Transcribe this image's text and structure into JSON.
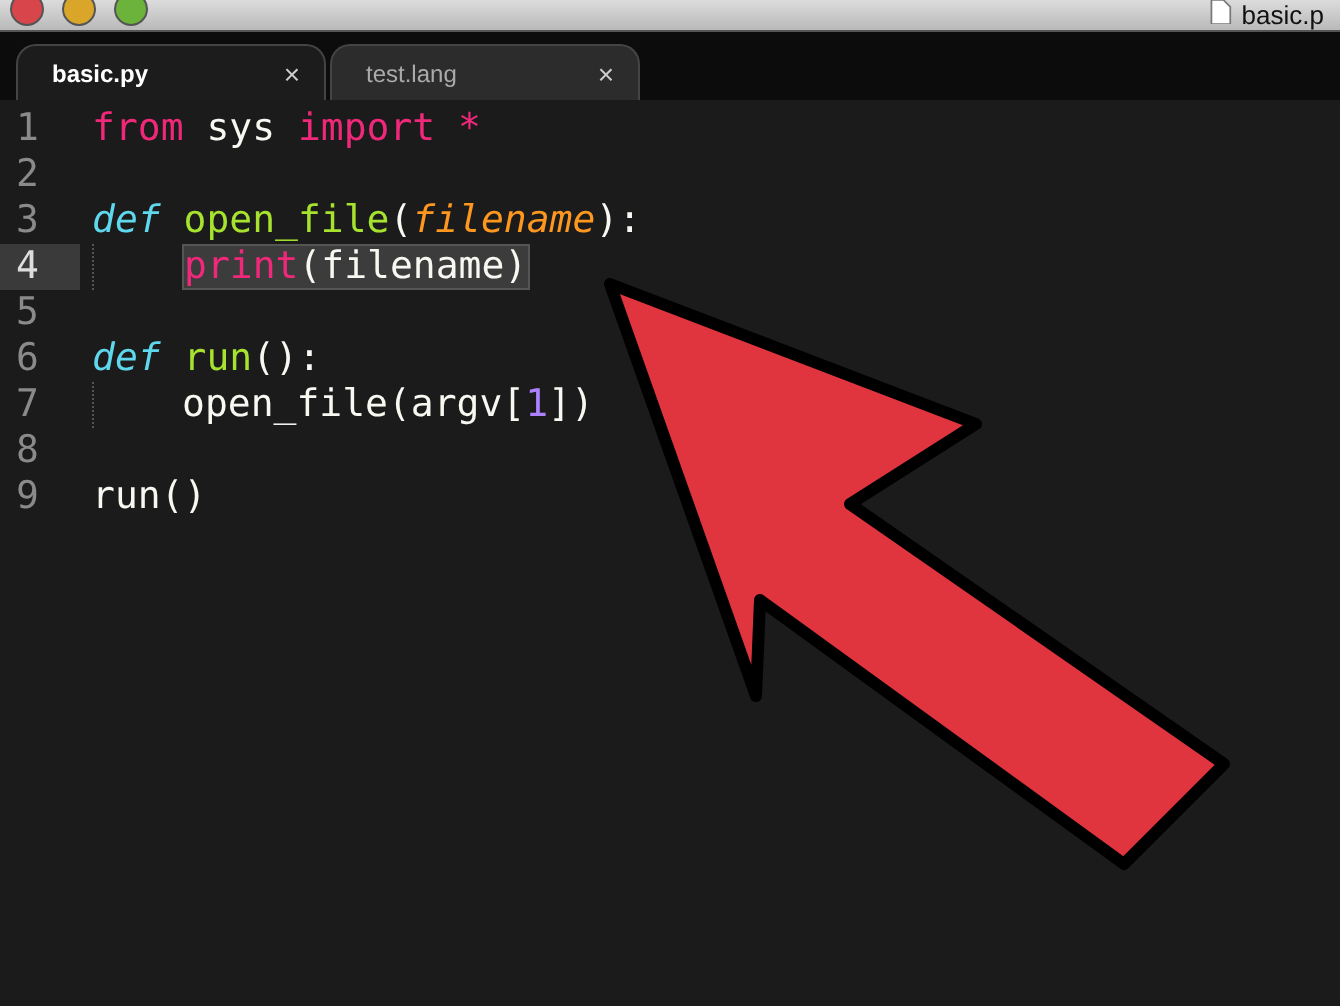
{
  "window": {
    "title": "basic.p"
  },
  "tabs": [
    {
      "label": "basic.py",
      "close": "×",
      "selected": true
    },
    {
      "label": "test.lang",
      "close": "×",
      "selected": false
    }
  ],
  "editor": {
    "lines": [
      {
        "number": "1",
        "current": false,
        "selected": false,
        "caret": false,
        "tokens": [
          {
            "kind": "keyword",
            "text": "from"
          },
          {
            "kind": "plain",
            "text": " sys "
          },
          {
            "kind": "keyword",
            "text": "import *"
          }
        ]
      },
      {
        "number": "2",
        "current": false,
        "selected": false,
        "caret": false
      },
      {
        "number": "3",
        "current": false,
        "selected": false,
        "caret": false,
        "tokens": [
          {
            "kind": "storage",
            "text": "def"
          },
          {
            "kind": "function",
            "text": " open_file"
          },
          {
            "kind": "plain",
            "text": "("
          },
          {
            "kind": "param",
            "text": "filename"
          },
          {
            "kind": "plain",
            "text": "):"
          }
        ]
      },
      {
        "number": "4",
        "current": true,
        "selected": true,
        "caret": true,
        "indent": true,
        "tokens": [
          {
            "kind": "keyword",
            "text": "print"
          },
          {
            "kind": "plain",
            "text": "(filename)"
          }
        ]
      },
      {
        "number": "5",
        "current": false,
        "selected": false,
        "caret": false
      },
      {
        "number": "6",
        "current": false,
        "selected": false,
        "caret": false,
        "tokens": [
          {
            "kind": "storage",
            "text": "def"
          },
          {
            "kind": "function",
            "text": " run"
          },
          {
            "kind": "plain",
            "text": "():"
          }
        ]
      },
      {
        "number": "7",
        "current": false,
        "selected": false,
        "caret": false,
        "indent": true,
        "tokens": [
          {
            "kind": "plain",
            "text": "open_file(argv["
          },
          {
            "kind": "number",
            "text": "1"
          },
          {
            "kind": "plain",
            "text": "])"
          }
        ]
      },
      {
        "number": "8",
        "current": false,
        "selected": false,
        "caret": false
      },
      {
        "number": "9",
        "current": false,
        "selected": false,
        "caret": false,
        "tokens": [
          {
            "kind": "plain",
            "text": "run()"
          }
        ]
      }
    ]
  }
}
